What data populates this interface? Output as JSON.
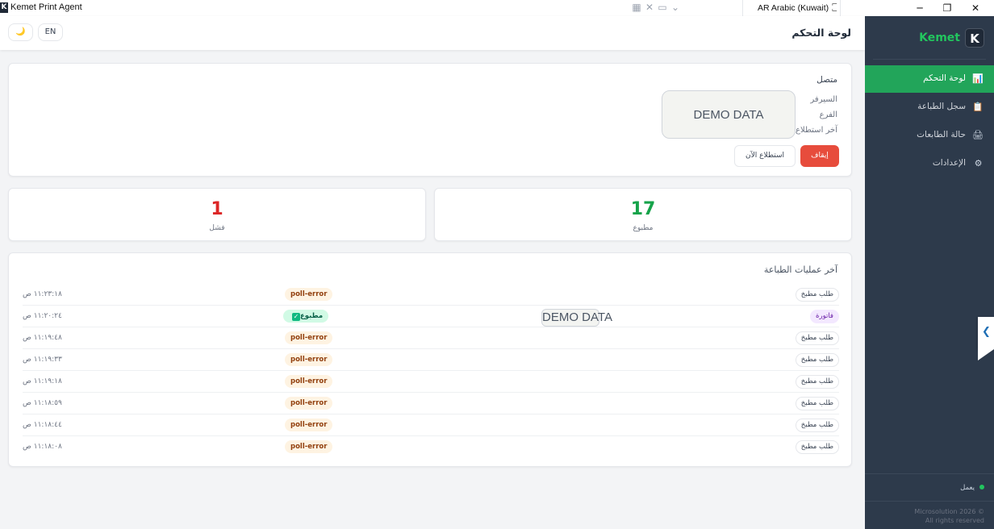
{
  "titlebar": {
    "app_icon": "K",
    "app_title": "Kemet Print Agent",
    "tools": [
      "grid-icon",
      "expand-icon",
      "monitor-icon",
      "chevron-down-icon"
    ],
    "language": "AR Arabic (Kuwait)",
    "minimize": "─",
    "restore": "❐",
    "close": "✕"
  },
  "topbar": {
    "theme_icon": "🌙",
    "lang_toggle": "EN",
    "page_title": "لوحة التحكم"
  },
  "status": {
    "connection": "متصل",
    "server_label": "السيرفر",
    "branch_label": "الفرع",
    "last_poll_label": "آخر استطلاع",
    "demo": "DEMO DATA",
    "stop_button": "إيقاف",
    "poll_now_button": "استطلاع الآن"
  },
  "stats": {
    "printed": {
      "value": "17",
      "label": "مطبوع",
      "color": "#16a34a"
    },
    "failed": {
      "value": "1",
      "label": "فشل",
      "color": "#dc2626"
    }
  },
  "jobs": {
    "title": "آخر عمليات الطباعة",
    "demo": "DEMO DATA",
    "rows": [
      {
        "type": "طلب مطبخ",
        "status": "poll-error",
        "time": "١١:٢٣:١٨ ص"
      },
      {
        "type": "فاتورة",
        "status": "مطبوع",
        "time": "١١:٢٠:٢٤ ص"
      },
      {
        "type": "طلب مطبخ",
        "status": "poll-error",
        "time": "١١:١٩:٤٨ ص"
      },
      {
        "type": "طلب مطبخ",
        "status": "poll-error",
        "time": "١١:١٩:٣٣ ص"
      },
      {
        "type": "طلب مطبخ",
        "status": "poll-error",
        "time": "١١:١٩:١٨ ص"
      },
      {
        "type": "طلب مطبخ",
        "status": "poll-error",
        "time": "١١:١٨:٥٩ ص"
      },
      {
        "type": "طلب مطبخ",
        "status": "poll-error",
        "time": "١١:١٨:٤٤ ص"
      },
      {
        "type": "طلب مطبخ",
        "status": "poll-error",
        "time": "١١:١٨:٠٨ ص"
      }
    ]
  },
  "sidebar": {
    "brand_name": "Kemet",
    "brand_logo": "K",
    "items": [
      {
        "label": "لوحة التحكم",
        "icon": "📊",
        "active": true
      },
      {
        "label": "سجل الطباعة",
        "icon": "📋",
        "active": false
      },
      {
        "label": "حالة الطابعات",
        "icon": "🖨",
        "active": false
      },
      {
        "label": "الإعدادات",
        "icon": "⚙",
        "active": false
      }
    ],
    "running": "يعمل",
    "copyright_line1": "Microsolution 2026 ©",
    "copyright_line2": "All rights reserved"
  },
  "colors": {
    "accent": "#22a55a",
    "sidebar_bg": "#2d3a4b",
    "danger": "#e74c3c"
  }
}
